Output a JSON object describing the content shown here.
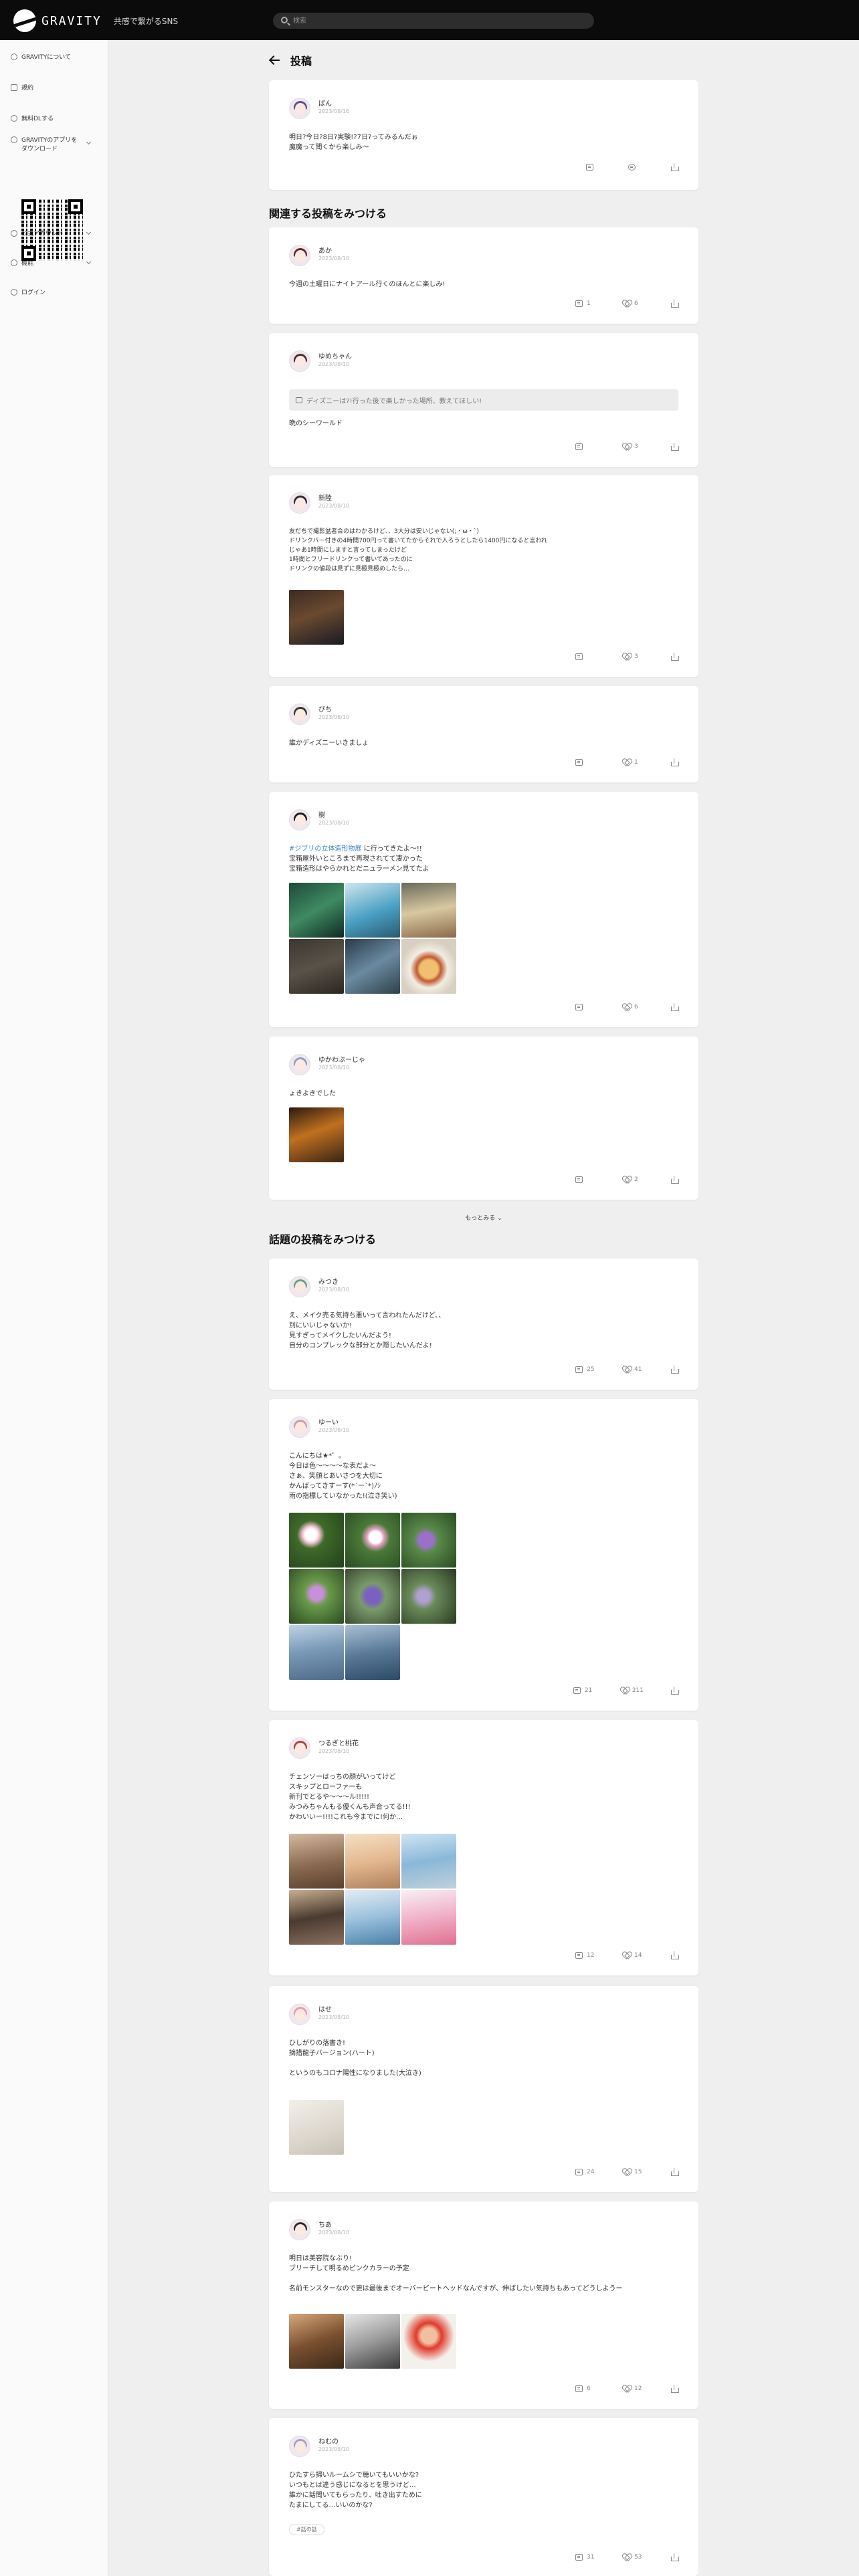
{
  "header": {
    "logo_text": "GRAVITY",
    "tagline": "共感で繋がるSNS",
    "search_placeholder": "検索"
  },
  "sidebar": {
    "items": [
      {
        "label": "GRAVITYについて",
        "icon": "gravity-icon"
      },
      {
        "label": "規約",
        "icon": "document-icon"
      },
      {
        "label": "無料DLする",
        "icon": "download-icon"
      },
      {
        "label": "GRAVITYのアプリをダウンロード",
        "icon": "app-icon"
      },
      {
        "label": "公式アカウント",
        "icon": "account-icon"
      },
      {
        "label": "機能",
        "icon": "feature-icon"
      },
      {
        "label": "ログイン",
        "icon": "login-icon"
      }
    ]
  },
  "page": {
    "title": "投稿",
    "related_heading": "関連する投稿をみつける",
    "more_label": "もっとみる",
    "trending_heading": "話題の投稿をみつける"
  },
  "main_post": {
    "user": "ぱん",
    "date": "2023/08/16",
    "text": "明日?今日?8日?実験!?7日?ってみるんだぉ\n魔魔って聞くから楽しみ〜",
    "avatar_color": "#5b4f8c"
  },
  "related_posts": [
    {
      "user": "あか",
      "date": "2023/08/10",
      "text": "今週の土曜日にナイトアール行くのほんとに楽しみ!",
      "comments": "1",
      "likes": "6",
      "avatar_color": "#5a2a2a"
    },
    {
      "user": "ゆめちゃん",
      "date": "2023/08/10",
      "quote": "ディズニーは?!行った後で楽しかった場所、教えてほしい!",
      "text": "晩のシーワールド",
      "comments": "",
      "likes": "3",
      "avatar_color": "#4a2c2c"
    },
    {
      "user": "新陸",
      "date": "2023/08/10",
      "text": "友だちで撮影盆者合のはわかるけど、、3大分は安いじゃない(;・ω・`)\nドリンクバー付きの4時間700円って書いてたからそれで入ろうとしたら1400円になると言われ\nじゃあ1時間にしますと言ってしまったけど\n1時間とフリードリンクって書いてあったのに\nドリンクの値段は見ずに見極見極めしたら…",
      "comments": "",
      "likes": "3",
      "avatar_color": "#2a2a3a"
    },
    {
      "user": "ぴち",
      "date": "2023/08/10",
      "text": "誰かディズニーいきましょ",
      "comments": "",
      "likes": "1",
      "avatar_color": "#2f3a2a"
    },
    {
      "user": "樹",
      "date": "2023/08/10",
      "link": "#ジブリの立体造形物展",
      "text": "に行ってきたよ〜!!\n宝箱屋外いところまで再現されてて凄かった\n宝箱造形はやらかれとだニュラーメン見てたよ",
      "comments": "",
      "likes": "6",
      "avatar_color": "#1a1a1a"
    },
    {
      "user": "ゆかわぷーじゃ",
      "date": "2023/08/10",
      "text": "ょきよきでした",
      "comments": "",
      "likes": "2",
      "avatar_color": "#8aa0c0"
    }
  ],
  "trending_posts": [
    {
      "user": "みつき",
      "date": "2023/08/10",
      "text": "え、メイク売る気持ち悪いって言われたんだけど、、\n別にいいじゃないか!\n見すぎってメイクしたいんだよう!\n自分のコンプレックな部分とか隠したいんだよ!",
      "comments": "25",
      "likes": "41",
      "avatar_color": "#6aa088"
    },
    {
      "user": "ゆーい",
      "date": "2023/08/10",
      "text": "こんにちは★*゜。\n今日は色〜〜〜〜な表だよ〜\nさぁ、笑顔とあいさつを大切に\nかんばってきすーす(*´ー`*)ﾉｼ\n雨の指標していなかった!(泣き笑い)",
      "comments": "21",
      "likes": "211",
      "avatar_color": "#c7a0a8"
    },
    {
      "user": "つるぎと桃花",
      "date": "2023/08/10",
      "text": "チェンソーはっちの顔がいってけど\nスキップとローファーも\n新刊でとるや〜〜〜ル!!!!!\nみつみちゃんもる優くんも声合ってる!!!\nかわいいー!!!!これも今までに!何か…",
      "comments": "12",
      "likes": "14",
      "avatar_color": "#b04040"
    },
    {
      "user": "はせ",
      "date": "2023/08/10",
      "text": "ひしがりの落書き!\n摘措龍子バージョン(ハート)\n\nというのもコロナ陽性になりました(大泣き)",
      "comments": "24",
      "likes": "15",
      "avatar_color": "#e4a0a8"
    },
    {
      "user": "ちあ",
      "date": "2023/08/10",
      "text": "明日は美容院なぶり!\nブリーチして明るめピンクカラーの予定\n\n名前モンスターなので更は最後までオーバービートヘッドなんですが、伸ばしたい気持ちもあってどうしようー",
      "comments": "6",
      "likes": "12",
      "avatar_color": "#2a2a2a"
    },
    {
      "user": "ねむの",
      "date": "2023/08/10",
      "text": "ひたすら掃いルームシで聴いてもいいかな?\nいつもとは違う感じになるとを思うけど…\n誰かに話聞いてもらったり、吐き出すために\nたまにしてる…いいのかな?",
      "tag": "#話の話",
      "comments": "31",
      "likes": "53",
      "avatar_color": "#a0a0c8"
    }
  ],
  "colors": {
    "accent_link": "#3d86c6",
    "background": "#efefef",
    "topbar": "#0b0b0b"
  }
}
